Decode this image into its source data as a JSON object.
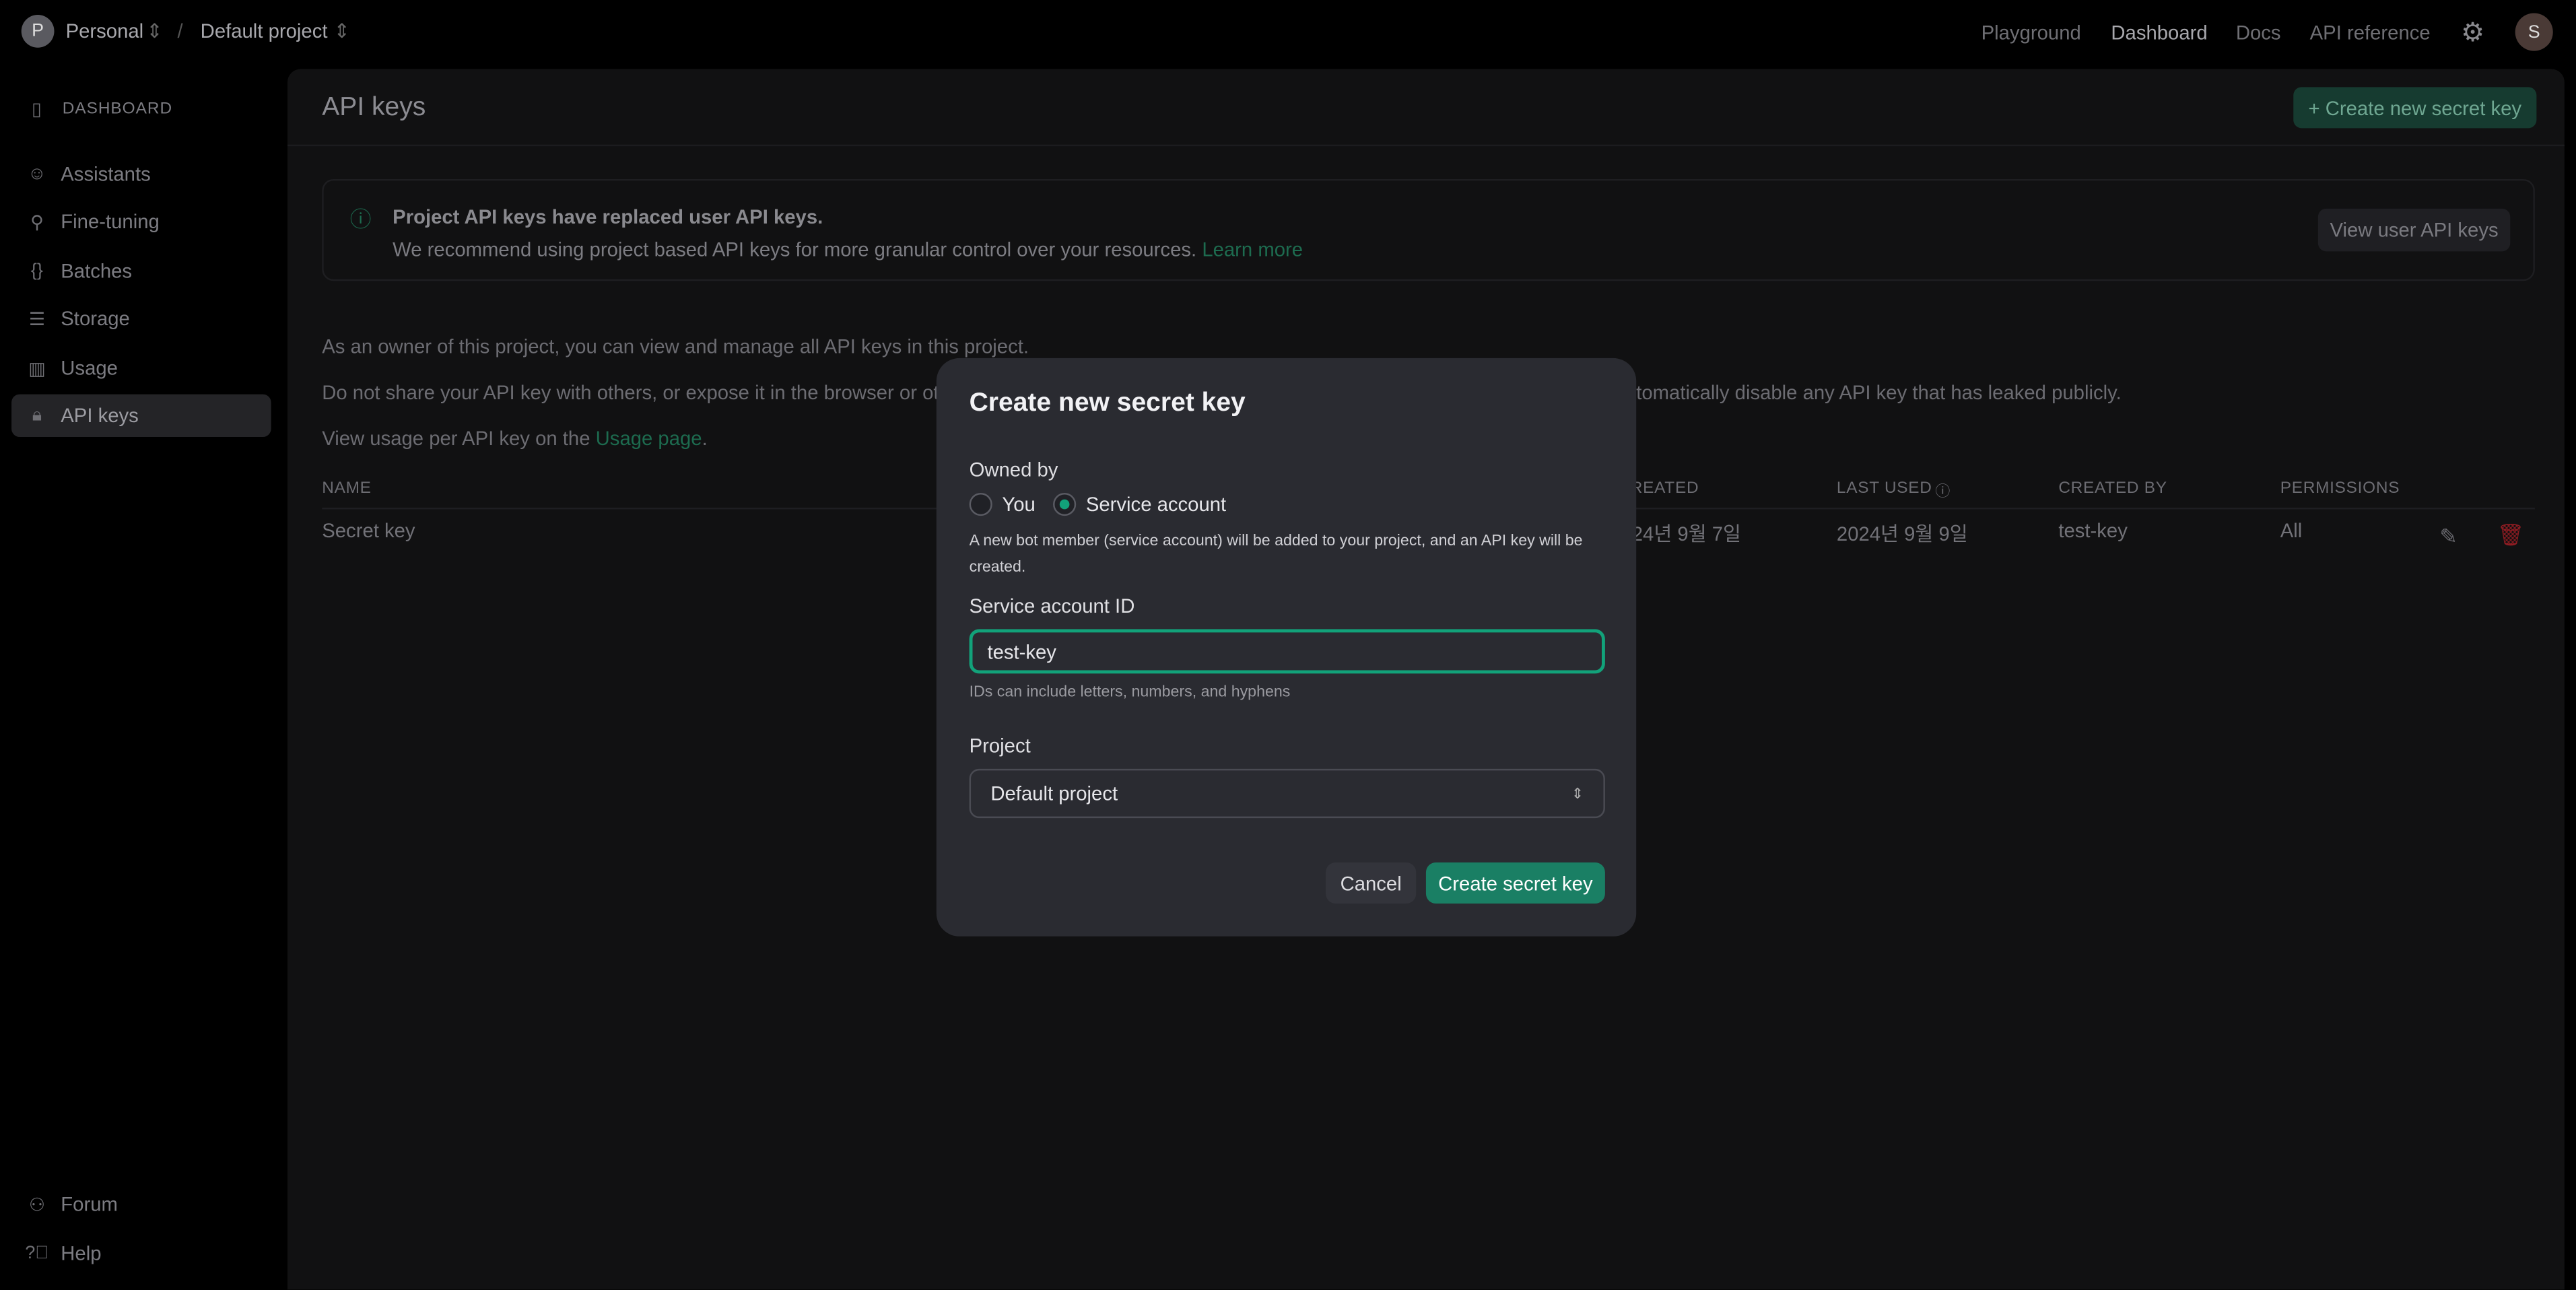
{
  "topbar": {
    "org_initial": "P",
    "org": "Personal",
    "separator": "/",
    "project": "Default project",
    "nav": [
      "Playground",
      "Dashboard",
      "Docs",
      "API reference"
    ],
    "user_initial": "S"
  },
  "sidebar": {
    "section": "DASHBOARD",
    "items": [
      {
        "label": "Assistants",
        "icon": "robot-icon"
      },
      {
        "label": "Fine-tuning",
        "icon": "sliders-icon"
      },
      {
        "label": "Batches",
        "icon": "braces-list-icon"
      },
      {
        "label": "Storage",
        "icon": "database-icon"
      },
      {
        "label": "Usage",
        "icon": "bar-chart-icon"
      },
      {
        "label": "API keys",
        "icon": "lock-icon",
        "active": true
      }
    ],
    "footer": [
      {
        "label": "Forum",
        "icon": "people-icon"
      },
      {
        "label": "Help",
        "icon": "help-icon"
      }
    ]
  },
  "main": {
    "title": "API keys",
    "create_button": "+ Create new secret key",
    "banner": {
      "title": "Project API keys have replaced user API keys.",
      "body": "We recommend using project based API keys for more granular control over your resources.",
      "link": "Learn more",
      "button": "View user API keys"
    },
    "para1": "As an owner of this project, you can view and manage all API keys in this project.",
    "para2a": "Do not share your API key with others, or expose it in the browser or other c",
    "para2b": "tomatically disable any API key that has leaked publicly.",
    "para3": "View usage per API key on the ",
    "para3_link": "Usage page",
    "para3_end": ".",
    "table": {
      "headers": [
        "NAME",
        "CREATED",
        "LAST USED",
        "CREATED BY",
        "PERMISSIONS"
      ],
      "rows": [
        [
          "Secret key",
          "2024년 9월 7일",
          "2024년 9월 9일",
          "test-key",
          "All"
        ]
      ]
    }
  },
  "modal": {
    "title": "Create new secret key",
    "owned_by": "Owned by",
    "options": [
      {
        "label": "You",
        "selected": false
      },
      {
        "label": "Service account",
        "selected": true
      }
    ],
    "note": "A new bot member (service account) will be added to your project, and an API key will be created.",
    "id_label": "Service account ID",
    "id_value": "test-key",
    "id_hint": "IDs can include letters, numbers, and hyphens",
    "project_label": "Project",
    "project_value": "Default project",
    "cancel": "Cancel",
    "submit": "Create secret key"
  },
  "colors": {
    "accent": "#1a7f64",
    "focus": "#12a27a",
    "danger": "#8e1c22"
  }
}
